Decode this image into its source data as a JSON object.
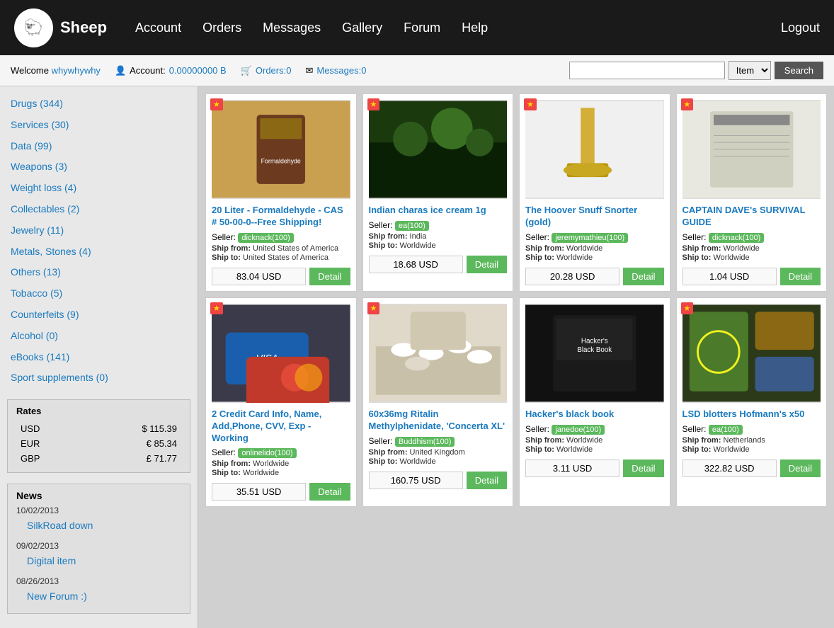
{
  "header": {
    "logo_text": "Sheep",
    "logo_emoji": "🐑",
    "nav": [
      {
        "label": "Account",
        "href": "#"
      },
      {
        "label": "Orders",
        "href": "#"
      },
      {
        "label": "Messages",
        "href": "#"
      },
      {
        "label": "Gallery",
        "href": "#"
      },
      {
        "label": "Forum",
        "href": "#"
      },
      {
        "label": "Help",
        "href": "#"
      }
    ],
    "logout_label": "Logout"
  },
  "topbar": {
    "welcome_text": "Welcome",
    "username": "whywhywhy",
    "account_label": "Account:",
    "account_balance": "0.00000000 B",
    "orders_label": "Orders:",
    "orders_count": "0",
    "messages_label": "Messages:",
    "messages_count": "0",
    "search_placeholder": "",
    "search_button": "Search",
    "item_option": "Item"
  },
  "sidebar": {
    "categories": [
      {
        "label": "Drugs",
        "count": "(344)",
        "href": "#"
      },
      {
        "label": "Services",
        "count": "(30)",
        "href": "#"
      },
      {
        "label": "Data",
        "count": "(99)",
        "href": "#"
      },
      {
        "label": "Weapons",
        "count": "(3)",
        "href": "#"
      },
      {
        "label": "Weight loss",
        "count": "(4)",
        "href": "#"
      },
      {
        "label": "Collectables",
        "count": "(2)",
        "href": "#"
      },
      {
        "label": "Jewelry",
        "count": "(11)",
        "href": "#"
      },
      {
        "label": "Metals, Stones",
        "count": "(4)",
        "href": "#"
      },
      {
        "label": "Others",
        "count": "(13)",
        "href": "#"
      },
      {
        "label": "Tobacco",
        "count": "(5)",
        "href": "#"
      },
      {
        "label": "Counterfeits",
        "count": "(9)",
        "href": "#"
      },
      {
        "label": "Alcohol",
        "count": "(0)",
        "href": "#"
      },
      {
        "label": "eBooks",
        "count": "(141)",
        "href": "#"
      },
      {
        "label": "Sport supplements",
        "count": "(0)",
        "href": "#"
      }
    ],
    "rates_title": "Rates",
    "rates": [
      {
        "currency": "USD",
        "symbol": "$",
        "value": "115.39"
      },
      {
        "currency": "EUR",
        "symbol": "€",
        "value": "85.34"
      },
      {
        "currency": "GBP",
        "symbol": "£",
        "value": "71.77"
      }
    ],
    "news_title": "News",
    "news_items": [
      {
        "date": "10/02/2013",
        "link_text": "SilkRoad down",
        "href": "#"
      },
      {
        "date": "09/02/2013",
        "link_text": "Digital item",
        "href": "#"
      },
      {
        "date": "08/26/2013",
        "link_text": "New Forum :)",
        "href": "#"
      }
    ]
  },
  "products": [
    {
      "id": 1,
      "starred": true,
      "title": "20 Liter - Formaldehyde - CAS # 50-00-0--Free Shipping!",
      "seller": "dicknack(100)",
      "seller_bg": "#5cb85c",
      "ship_from": "United States of America",
      "ship_to": "United States of America",
      "price": "83.04 USD",
      "img_class": "img-brown",
      "img_label": "Formaldehyde bottle"
    },
    {
      "id": 2,
      "starred": true,
      "title": "Indian charas ice cream 1g",
      "seller": "ea(100)",
      "seller_bg": "#5cb85c",
      "ship_from": "India",
      "ship_to": "Worldwide",
      "price": "18.68 USD",
      "img_class": "img-green",
      "img_label": "Indian charas"
    },
    {
      "id": 3,
      "starred": true,
      "title": "The Hoover Snuff Snorter (gold)",
      "seller": "jeremymathieu(100)",
      "seller_bg": "#5cb85c",
      "ship_from": "Worldwide",
      "ship_to": "Worldwide",
      "price": "20.28 USD",
      "img_class": "img-gold",
      "img_label": "Gold snorter"
    },
    {
      "id": 4,
      "starred": true,
      "title": "CAPTAIN DAVE's SURVIVAL GUIDE",
      "seller": "dicknack(100)",
      "seller_bg": "#5cb85c",
      "ship_from": "Worldwide",
      "ship_to": "Worldwide",
      "price": "1.04 USD",
      "img_class": "img-light",
      "img_label": "Survival guide book"
    },
    {
      "id": 5,
      "starred": true,
      "title": "2 Credit Card Info, Name, Add,Phone, CVV, Exp - Working",
      "seller": "onlinelido(100)",
      "seller_bg": "#5cb85c",
      "ship_from": "Worldwide",
      "ship_to": "Worldwide",
      "price": "35.51 USD",
      "img_class": "img-blue",
      "img_label": "Credit cards"
    },
    {
      "id": 6,
      "starred": true,
      "title": "60x36mg Ritalin Methylphenidate, 'Concerta XL'",
      "seller": "Buddhism(100)",
      "seller_bg": "#5cb85c",
      "ship_from": "United Kingdom",
      "ship_to": "Worldwide",
      "price": "160.75 USD",
      "img_class": "img-pills",
      "img_label": "Ritalin pills"
    },
    {
      "id": 7,
      "starred": false,
      "title": "Hacker's black book",
      "seller": "janedoe(100)",
      "seller_bg": "#5cb85c",
      "ship_from": "Worldwide",
      "ship_to": "Worldwide",
      "price": "3.11 USD",
      "img_class": "img-dark",
      "img_label": "Hacker black book"
    },
    {
      "id": 8,
      "starred": true,
      "title": "LSD blotters Hofmann's x50",
      "seller": "ea(100)",
      "seller_bg": "#5cb85c",
      "ship_from": "Netherlands",
      "ship_to": "Worldwide",
      "price": "322.82 USD",
      "img_class": "img-colorful",
      "img_label": "LSD blotters"
    }
  ]
}
